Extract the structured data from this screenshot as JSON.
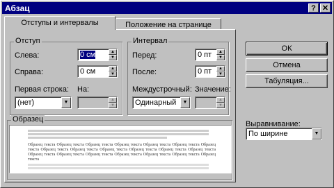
{
  "window": {
    "title": "Абзац",
    "help_label": "?",
    "close_label": "✕"
  },
  "tabs": [
    {
      "label": "Отступы и интервалы"
    },
    {
      "label": "Положение на странице"
    }
  ],
  "indent_group": {
    "title": "Отступ",
    "left_label": "Слева:",
    "left_value": "0 см",
    "right_label": "Справа:",
    "right_value": "0 см",
    "first_line_label": "Первая строка:",
    "first_line_value": "(нет)",
    "on_label": "На:",
    "on_value": ""
  },
  "spacing_group": {
    "title": "Интервал",
    "before_label": "Перед:",
    "before_value": "0 пт",
    "after_label": "После:",
    "after_value": "0 пт",
    "line_spacing_label": "Междустрочный:",
    "line_spacing_value": "Одинарный",
    "value_label": "Значение:",
    "value_value": ""
  },
  "preview": {
    "title": "Образец",
    "sample_text": "Образец текста Образец текста Образец текста Образец текста Образец текста Образец текста Образец текста Образец текста Образец текста Образец текста Образец текста Образец текста Образец текста Образец текста Образец текста Образец текста Образец текста Образец текста Образец текста Образец текста"
  },
  "buttons": {
    "ok": "ОК",
    "cancel": "Отмена",
    "tabs": "Табуляция..."
  },
  "alignment": {
    "label": "Выравнивание:",
    "value": "По ширине"
  },
  "icons": {
    "spin_up": "up-arrow-icon",
    "spin_down": "down-arrow-icon",
    "dropdown": "dropdown-arrow-icon"
  },
  "colors": {
    "title_bar": "#000080",
    "face": "#c0c0c0",
    "selection": "#000080"
  }
}
